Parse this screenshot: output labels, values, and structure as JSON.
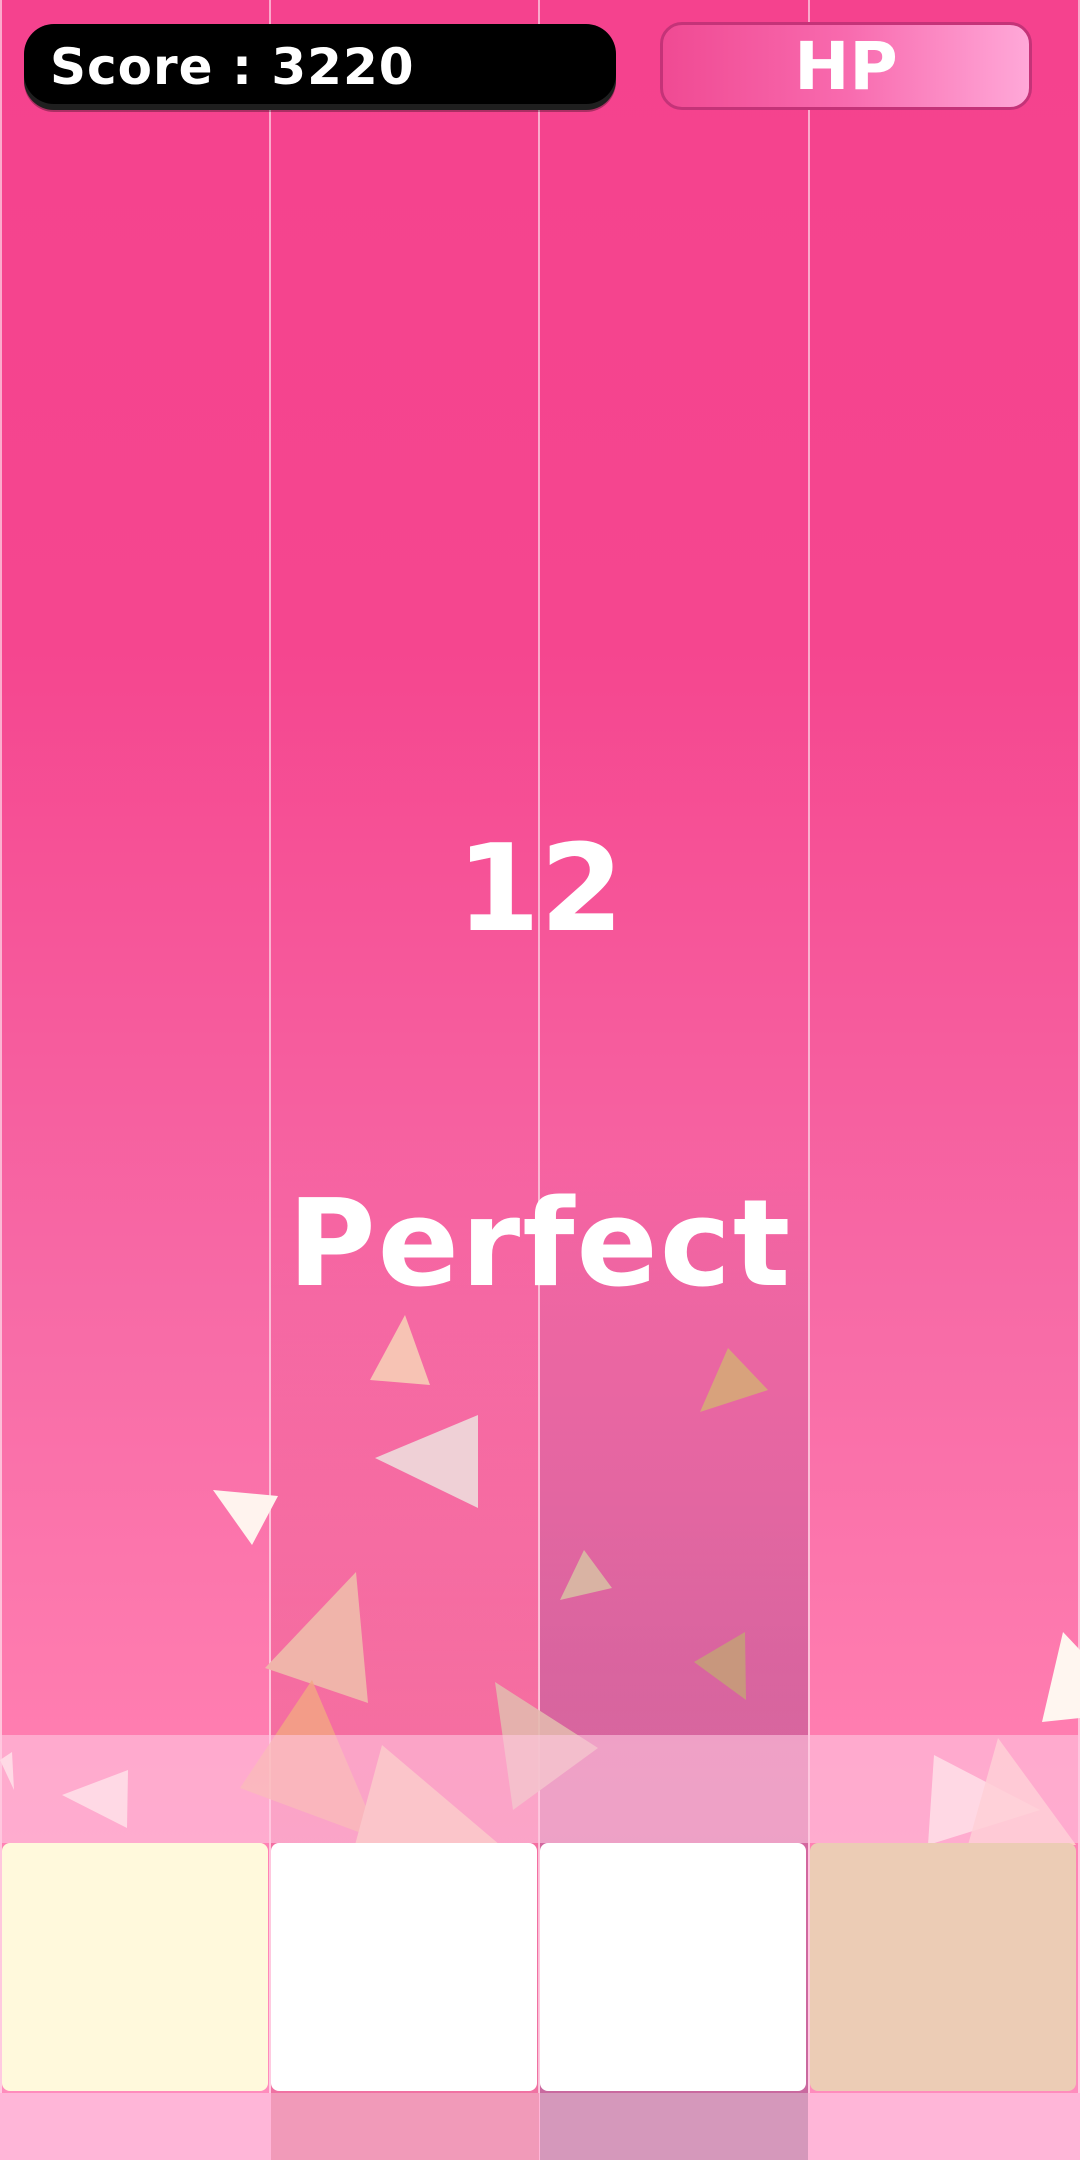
{
  "hud": {
    "score_text": "Score : 3220",
    "hp_label": "HP"
  },
  "combo": "12",
  "judgement": "Perfect",
  "colors": {
    "background_top": "#f5428e",
    "background_bottom": "#ff8fbf",
    "key_1": "#fff9dc",
    "key_2": "#ffffff",
    "key_3": "#ffffff",
    "key_4": "#ecccb5"
  }
}
